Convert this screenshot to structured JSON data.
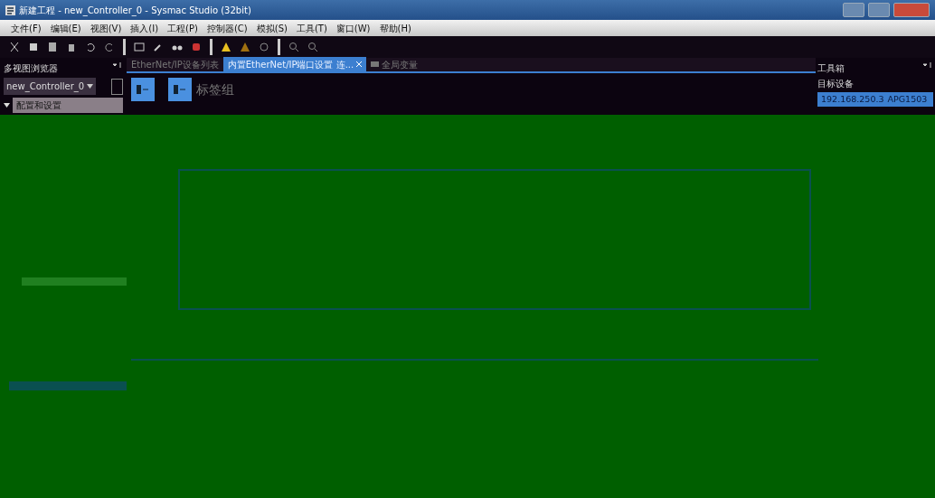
{
  "window": {
    "title": "新建工程 - new_Controller_0 - Sysmac Studio (32bit)"
  },
  "menu": [
    "文件(F)",
    "编辑(E)",
    "视图(V)",
    "插入(I)",
    "工程(P)",
    "控制器(C)",
    "模拟(S)",
    "工具(T)",
    "窗口(W)",
    "帮助(H)"
  ],
  "left_panel": {
    "title": "多视图浏览器",
    "controller": "new_Controller_0",
    "tree": [
      {
        "label": "配置和设置",
        "expanded": true
      }
    ]
  },
  "tabs": [
    {
      "label": "EtherNet/IP设备列表",
      "selected": false,
      "closable": false
    },
    {
      "label": "内置EtherNet/IP端口设置 连...",
      "selected": true,
      "closable": true
    },
    {
      "label": "全局变量",
      "selected": false,
      "closable": false
    }
  ],
  "editor": {
    "heading": "标签组"
  },
  "toolbox": {
    "title": "工具箱",
    "section": "目标设备",
    "devices": [
      {
        "address": "192.168.250.3",
        "name": "APG1503",
        "selected": true
      }
    ]
  }
}
